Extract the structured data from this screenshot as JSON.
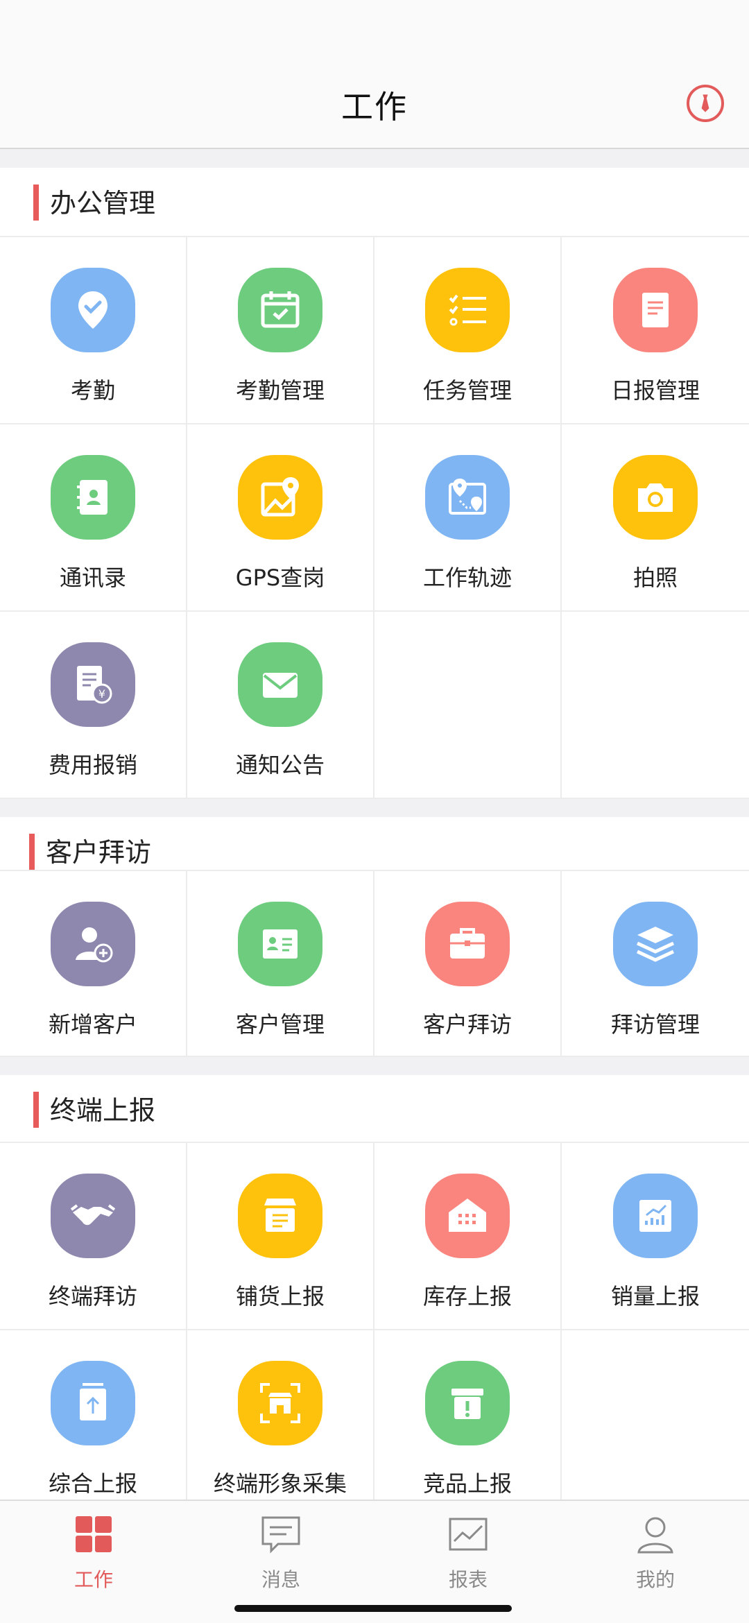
{
  "header": {
    "title": "工作"
  },
  "sections": [
    {
      "title": "办公管理",
      "items": [
        {
          "label": "考勤",
          "icon": "location-check-icon",
          "color": "#7fb5f3"
        },
        {
          "label": "考勤管理",
          "icon": "calendar-check-icon",
          "color": "#6dcc7e"
        },
        {
          "label": "任务管理",
          "icon": "checklist-icon",
          "color": "#fec20d"
        },
        {
          "label": "日报管理",
          "icon": "document-icon",
          "color": "#f9857e"
        },
        {
          "label": "通讯录",
          "icon": "contacts-book-icon",
          "color": "#6dcc7e"
        },
        {
          "label": "GPS查岗",
          "icon": "map-pin-icon",
          "color": "#fec20d"
        },
        {
          "label": "工作轨迹",
          "icon": "route-map-icon",
          "color": "#7fb5f3"
        },
        {
          "label": "拍照",
          "icon": "camera-icon",
          "color": "#fec20d"
        },
        {
          "label": "费用报销",
          "icon": "expense-receipt-icon",
          "color": "#8f88ae"
        },
        {
          "label": "通知公告",
          "icon": "mail-icon",
          "color": "#6dcc7e"
        }
      ]
    },
    {
      "title": "客户拜访",
      "items": [
        {
          "label": "新增客户",
          "icon": "add-user-icon",
          "color": "#8f88ae"
        },
        {
          "label": "客户管理",
          "icon": "id-card-icon",
          "color": "#6dcc7e"
        },
        {
          "label": "客户拜访",
          "icon": "briefcase-icon",
          "color": "#f9857e"
        },
        {
          "label": "拜访管理",
          "icon": "layers-icon",
          "color": "#7fb5f3"
        }
      ]
    },
    {
      "title": "终端上报",
      "items": [
        {
          "label": "终端拜访",
          "icon": "handshake-icon",
          "color": "#8f88ae"
        },
        {
          "label": "铺货上报",
          "icon": "store-icon",
          "color": "#fec20d"
        },
        {
          "label": "库存上报",
          "icon": "warehouse-icon",
          "color": "#f9857e"
        },
        {
          "label": "销量上报",
          "icon": "sales-chart-icon",
          "color": "#7fb5f3"
        },
        {
          "label": "综合上报",
          "icon": "upload-icon",
          "color": "#7fb5f3"
        },
        {
          "label": "终端形象采集",
          "icon": "shop-scan-icon",
          "color": "#fec20d"
        },
        {
          "label": "竞品上报",
          "icon": "alert-box-icon",
          "color": "#6dcc7e"
        }
      ]
    }
  ],
  "tabs": [
    {
      "label": "工作",
      "icon": "grid-icon",
      "active": true
    },
    {
      "label": "消息",
      "icon": "message-icon",
      "active": false
    },
    {
      "label": "报表",
      "icon": "chart-icon",
      "active": false
    },
    {
      "label": "我的",
      "icon": "person-icon",
      "active": false
    }
  ],
  "colors": {
    "accent": "#e25a5a",
    "inactive": "#8a8a8a"
  }
}
